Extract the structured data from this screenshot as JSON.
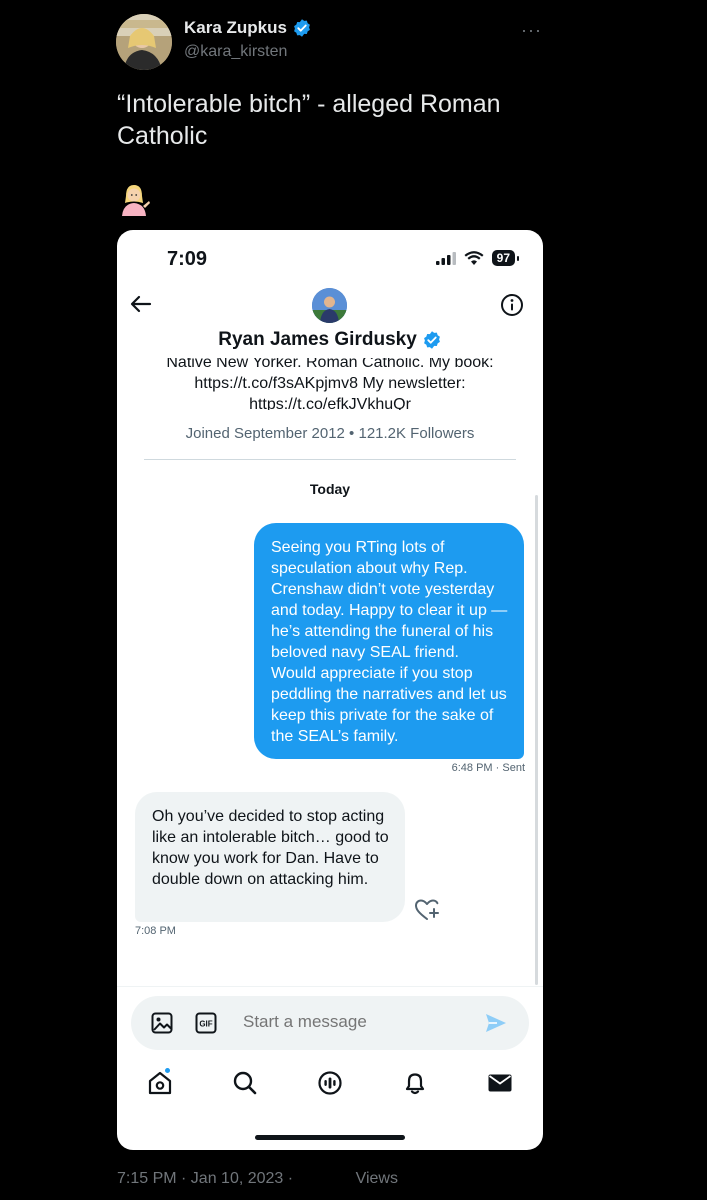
{
  "tweet": {
    "author_name": "Kara Zupkus",
    "author_handle": "@kara_kirsten",
    "more_label": "···",
    "text": "“Intolerable bitch” - alleged Roman Catholic",
    "emoji": "person-tipping-hand-emoji",
    "timestamp": "7:15 PM · Jan 10, 2023 ·",
    "views_label": "Views"
  },
  "screenshot": {
    "status_time": "7:09",
    "battery": "97",
    "conversation": {
      "name": "Ryan James Girdusky",
      "bio": "Native New Yorker. Roman Catholic. My book: https://t.co/f3sAKpjmv8 My newsletter: https://t.co/efkJVkhuQr",
      "joined": "Joined September 2012 • 121.2K Followers",
      "day_label": "Today"
    },
    "messages": [
      {
        "direction": "sent",
        "text": "Seeing you RTing lots of speculation about why Rep. Crenshaw didn’t vote yesterday and today. Happy to clear it up — he’s attending the funeral of his beloved navy SEAL friend. Would appreciate if you stop peddling the narratives and let us keep this private for the sake of the SEAL’s family.",
        "meta": "6:48 PM · Sent"
      },
      {
        "direction": "received",
        "text": "Oh you’ve decided to stop acting like an intolerable bitch… good to know you work for Dan. Have to double down on attacking him.",
        "meta": "7:08 PM"
      }
    ],
    "composer": {
      "placeholder": "Start a message"
    },
    "tabbar_icons": [
      "home-icon",
      "search-icon",
      "spaces-icon",
      "notifications-icon",
      "messages-icon"
    ]
  },
  "colors": {
    "accent": "#1d9bf0",
    "background": "#000000",
    "card": "#ffffff"
  }
}
